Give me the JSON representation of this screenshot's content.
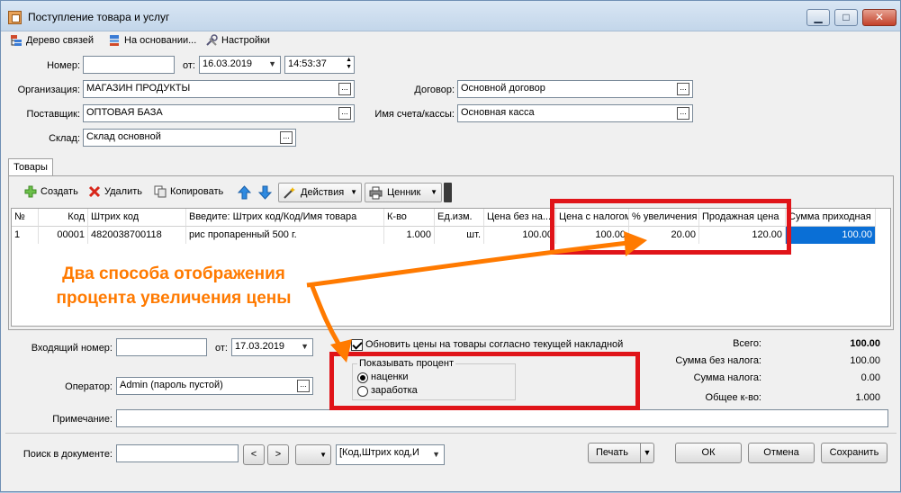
{
  "window": {
    "title": "Поступление товара и услуг",
    "min": "▁",
    "max": "□",
    "close": "✕"
  },
  "toolbar": {
    "tree": "Дерево связей",
    "based": "На основании...",
    "settings": "Настройки"
  },
  "header": {
    "number_label": "Номер:",
    "number_value": "",
    "from_label": "от:",
    "date": "16.03.2019",
    "time": "14:53:37",
    "org_label": "Организация:",
    "org": "МАГАЗИН ПРОДУКТЫ",
    "supplier_label": "Поставщик:",
    "supplier": "ОПТОВАЯ БАЗА",
    "warehouse_label": "Склад:",
    "warehouse": "Склад основной",
    "contract_label": "Договор:",
    "contract": "Основной договор",
    "account_label": "Имя счета/кассы:",
    "account": "Основная касса"
  },
  "tab": "Товары",
  "grid_toolbar": {
    "create": "Создать",
    "delete": "Удалить",
    "copy": "Копировать",
    "actions": "Действия",
    "price_tag": "Ценник"
  },
  "table": {
    "columns": [
      "№",
      "Код",
      "Штрих код",
      "Введите: Штрих код/Код/Имя товара",
      "К-во",
      "Ед.изм.",
      "Цена без на...",
      "Цена с налогом",
      "% увеличения",
      "Продажная цена",
      "Сумма приходная"
    ],
    "rows": [
      [
        "1",
        "00001",
        "4820038700118",
        "рис пропаренный 500 г.",
        "1.000",
        "шт.",
        "100.00",
        "100.00",
        "20.00",
        "120.00",
        "100.00"
      ]
    ]
  },
  "footer": {
    "incoming_label": "Входящий номер:",
    "incoming": "",
    "from_label": "от:",
    "incoming_date": "17.03.2019",
    "operator_label": "Оператор:",
    "operator": "Admin (пароль пустой)",
    "note_label": "Примечание:",
    "note": "",
    "update_prices": "Обновить цены на товары согласно текущей накладной",
    "show_percent": "Показывать процент",
    "opt_markup": "наценки",
    "opt_profit": "заработка",
    "total_label": "Всего:",
    "total": "100.00",
    "no_tax_label": "Сумма без налога:",
    "no_tax": "100.00",
    "tax_label": "Сумма налога:",
    "tax": "0.00",
    "qty_label": "Общее к-во:",
    "qty": "1.000"
  },
  "bottom": {
    "search_label": "Поиск в документе:",
    "search": "",
    "prev": "<",
    "next": ">",
    "search_field": "[Код,Штрих код,И",
    "print": "Печать",
    "ok": "ОК",
    "cancel": "Отмена",
    "save": "Сохранить"
  },
  "callout": {
    "line1": "Два способа отображения",
    "line2": "процента увеличения цены"
  },
  "colors": {
    "accent": "#0a6fd6",
    "annotation": "#e01419",
    "callout": "#ff7a00"
  }
}
